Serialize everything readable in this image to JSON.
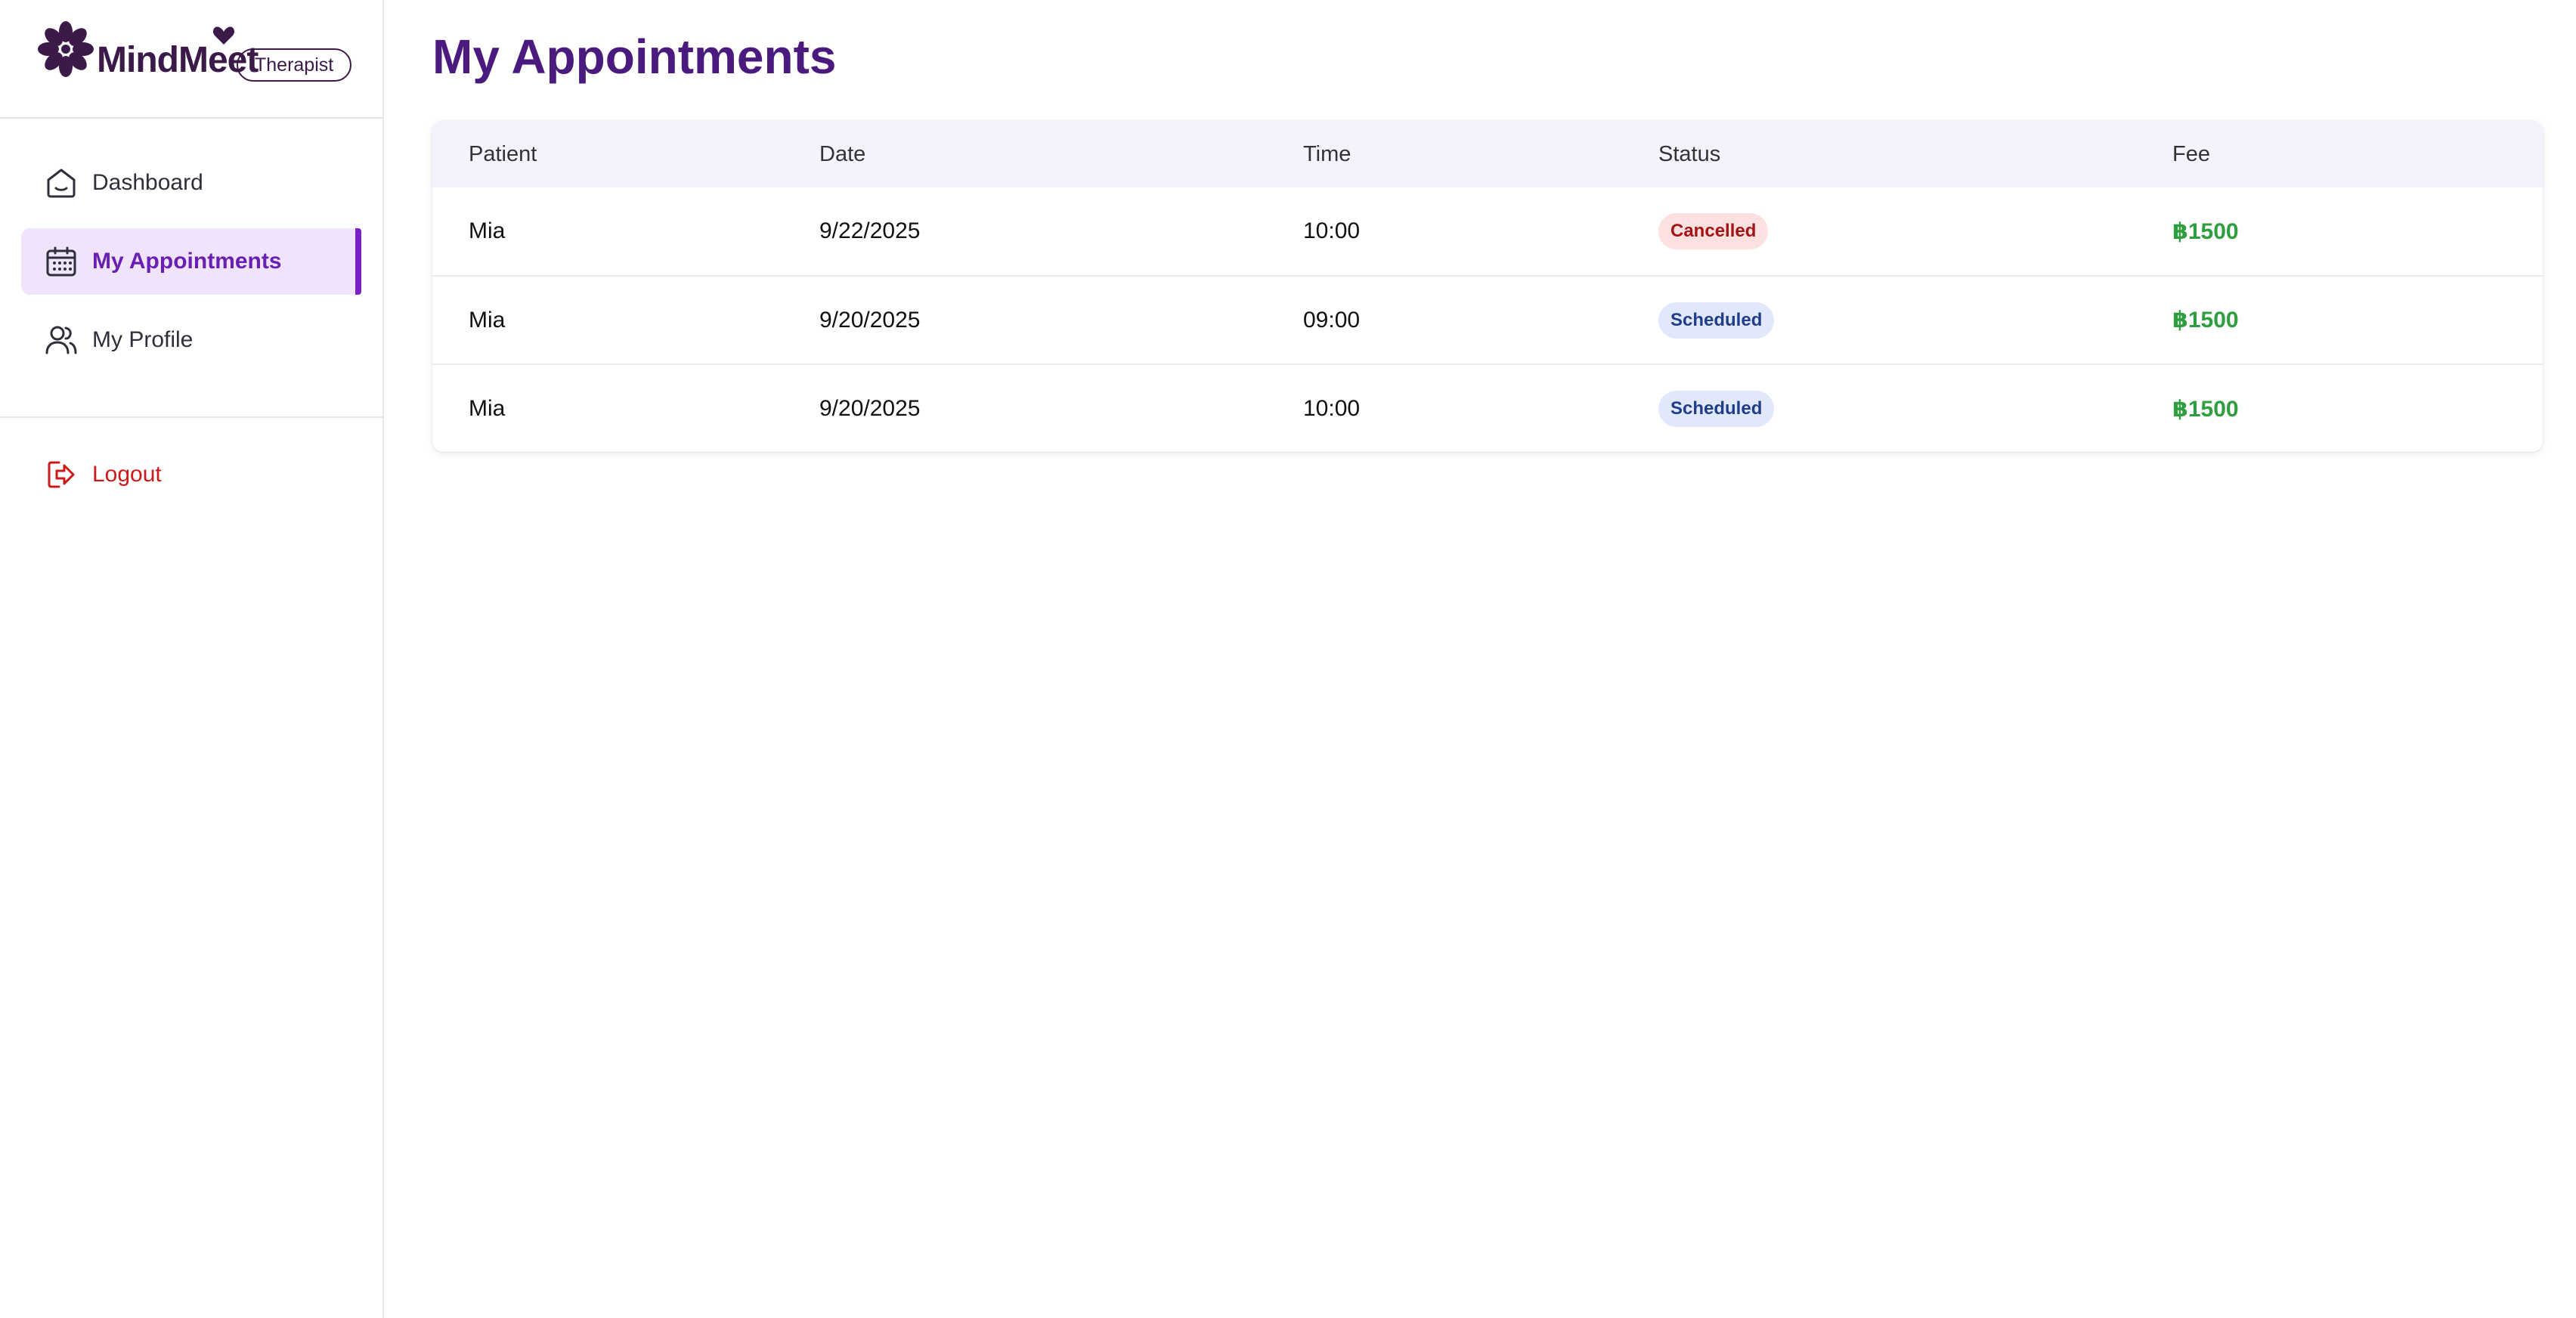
{
  "brand": {
    "name": "MindMeet",
    "role": "Therapist",
    "colors": {
      "logo": "#3b1a4a"
    },
    "icons": {
      "logo": "flower-icon",
      "accent": "heart-icon"
    }
  },
  "sidebar": {
    "items": [
      {
        "label": "Dashboard",
        "icon": "home-icon",
        "active": false
      },
      {
        "label": "My Appointments",
        "icon": "calendar-icon",
        "active": true
      },
      {
        "label": "My Profile",
        "icon": "users-icon",
        "active": false
      }
    ],
    "logout": {
      "label": "Logout",
      "icon": "logout-icon",
      "color": "#cc1a1a"
    },
    "colors": {
      "active_bg": "#efe4fb",
      "active_text": "#6a1fb4",
      "active_bar": "#7a20c8"
    }
  },
  "main": {
    "title": "My Appointments",
    "title_color": "#4a1a7e",
    "table": {
      "columns": [
        "Patient",
        "Date",
        "Time",
        "Status",
        "Fee"
      ],
      "rows": [
        {
          "patient": "Mia",
          "date": "9/22/2025",
          "time": "10:00",
          "status": "Cancelled",
          "fee": "฿1500"
        },
        {
          "patient": "Mia",
          "date": "9/20/2025",
          "time": "09:00",
          "status": "Scheduled",
          "fee": "฿1500"
        },
        {
          "patient": "Mia",
          "date": "9/20/2025",
          "time": "10:00",
          "status": "Scheduled",
          "fee": "฿1500"
        }
      ]
    },
    "status_colors": {
      "Cancelled": {
        "bg": "#fde0e0",
        "fg": "#a31515"
      },
      "Scheduled": {
        "bg": "#e1e8fb",
        "fg": "#1f3d8a"
      }
    },
    "fee_color": "#2e9e3e"
  }
}
